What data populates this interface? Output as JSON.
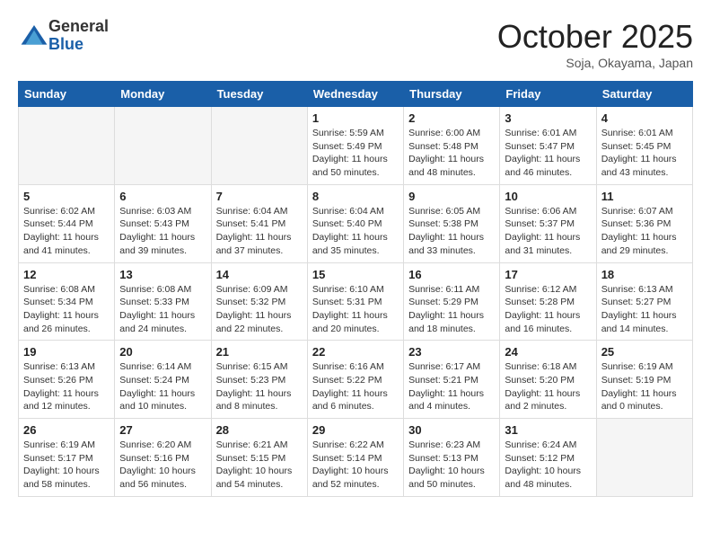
{
  "header": {
    "logo_general": "General",
    "logo_blue": "Blue",
    "month": "October 2025",
    "location": "Soja, Okayama, Japan"
  },
  "days_of_week": [
    "Sunday",
    "Monday",
    "Tuesday",
    "Wednesday",
    "Thursday",
    "Friday",
    "Saturday"
  ],
  "weeks": [
    [
      {
        "day": "",
        "info": ""
      },
      {
        "day": "",
        "info": ""
      },
      {
        "day": "",
        "info": ""
      },
      {
        "day": "1",
        "info": "Sunrise: 5:59 AM\nSunset: 5:49 PM\nDaylight: 11 hours\nand 50 minutes."
      },
      {
        "day": "2",
        "info": "Sunrise: 6:00 AM\nSunset: 5:48 PM\nDaylight: 11 hours\nand 48 minutes."
      },
      {
        "day": "3",
        "info": "Sunrise: 6:01 AM\nSunset: 5:47 PM\nDaylight: 11 hours\nand 46 minutes."
      },
      {
        "day": "4",
        "info": "Sunrise: 6:01 AM\nSunset: 5:45 PM\nDaylight: 11 hours\nand 43 minutes."
      }
    ],
    [
      {
        "day": "5",
        "info": "Sunrise: 6:02 AM\nSunset: 5:44 PM\nDaylight: 11 hours\nand 41 minutes."
      },
      {
        "day": "6",
        "info": "Sunrise: 6:03 AM\nSunset: 5:43 PM\nDaylight: 11 hours\nand 39 minutes."
      },
      {
        "day": "7",
        "info": "Sunrise: 6:04 AM\nSunset: 5:41 PM\nDaylight: 11 hours\nand 37 minutes."
      },
      {
        "day": "8",
        "info": "Sunrise: 6:04 AM\nSunset: 5:40 PM\nDaylight: 11 hours\nand 35 minutes."
      },
      {
        "day": "9",
        "info": "Sunrise: 6:05 AM\nSunset: 5:38 PM\nDaylight: 11 hours\nand 33 minutes."
      },
      {
        "day": "10",
        "info": "Sunrise: 6:06 AM\nSunset: 5:37 PM\nDaylight: 11 hours\nand 31 minutes."
      },
      {
        "day": "11",
        "info": "Sunrise: 6:07 AM\nSunset: 5:36 PM\nDaylight: 11 hours\nand 29 minutes."
      }
    ],
    [
      {
        "day": "12",
        "info": "Sunrise: 6:08 AM\nSunset: 5:34 PM\nDaylight: 11 hours\nand 26 minutes."
      },
      {
        "day": "13",
        "info": "Sunrise: 6:08 AM\nSunset: 5:33 PM\nDaylight: 11 hours\nand 24 minutes."
      },
      {
        "day": "14",
        "info": "Sunrise: 6:09 AM\nSunset: 5:32 PM\nDaylight: 11 hours\nand 22 minutes."
      },
      {
        "day": "15",
        "info": "Sunrise: 6:10 AM\nSunset: 5:31 PM\nDaylight: 11 hours\nand 20 minutes."
      },
      {
        "day": "16",
        "info": "Sunrise: 6:11 AM\nSunset: 5:29 PM\nDaylight: 11 hours\nand 18 minutes."
      },
      {
        "day": "17",
        "info": "Sunrise: 6:12 AM\nSunset: 5:28 PM\nDaylight: 11 hours\nand 16 minutes."
      },
      {
        "day": "18",
        "info": "Sunrise: 6:13 AM\nSunset: 5:27 PM\nDaylight: 11 hours\nand 14 minutes."
      }
    ],
    [
      {
        "day": "19",
        "info": "Sunrise: 6:13 AM\nSunset: 5:26 PM\nDaylight: 11 hours\nand 12 minutes."
      },
      {
        "day": "20",
        "info": "Sunrise: 6:14 AM\nSunset: 5:24 PM\nDaylight: 11 hours\nand 10 minutes."
      },
      {
        "day": "21",
        "info": "Sunrise: 6:15 AM\nSunset: 5:23 PM\nDaylight: 11 hours\nand 8 minutes."
      },
      {
        "day": "22",
        "info": "Sunrise: 6:16 AM\nSunset: 5:22 PM\nDaylight: 11 hours\nand 6 minutes."
      },
      {
        "day": "23",
        "info": "Sunrise: 6:17 AM\nSunset: 5:21 PM\nDaylight: 11 hours\nand 4 minutes."
      },
      {
        "day": "24",
        "info": "Sunrise: 6:18 AM\nSunset: 5:20 PM\nDaylight: 11 hours\nand 2 minutes."
      },
      {
        "day": "25",
        "info": "Sunrise: 6:19 AM\nSunset: 5:19 PM\nDaylight: 11 hours\nand 0 minutes."
      }
    ],
    [
      {
        "day": "26",
        "info": "Sunrise: 6:19 AM\nSunset: 5:17 PM\nDaylight: 10 hours\nand 58 minutes."
      },
      {
        "day": "27",
        "info": "Sunrise: 6:20 AM\nSunset: 5:16 PM\nDaylight: 10 hours\nand 56 minutes."
      },
      {
        "day": "28",
        "info": "Sunrise: 6:21 AM\nSunset: 5:15 PM\nDaylight: 10 hours\nand 54 minutes."
      },
      {
        "day": "29",
        "info": "Sunrise: 6:22 AM\nSunset: 5:14 PM\nDaylight: 10 hours\nand 52 minutes."
      },
      {
        "day": "30",
        "info": "Sunrise: 6:23 AM\nSunset: 5:13 PM\nDaylight: 10 hours\nand 50 minutes."
      },
      {
        "day": "31",
        "info": "Sunrise: 6:24 AM\nSunset: 5:12 PM\nDaylight: 10 hours\nand 48 minutes."
      },
      {
        "day": "",
        "info": ""
      }
    ]
  ]
}
